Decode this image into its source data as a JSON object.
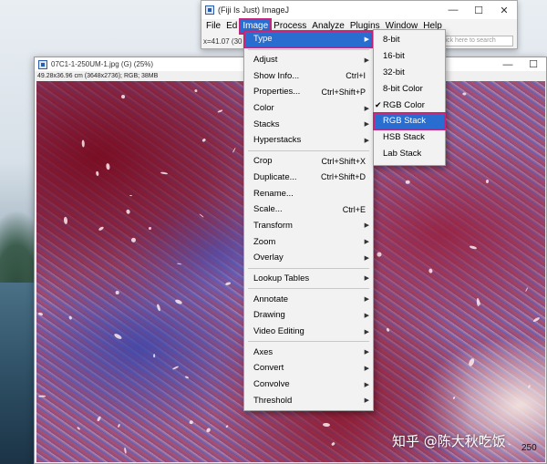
{
  "main_window": {
    "title": "(Fiji Is Just) ImageJ",
    "menus": [
      "File",
      "Ed",
      "Image",
      "Process",
      "Analyze",
      "Plugins",
      "Window",
      "Help"
    ],
    "active_menu": "Image",
    "status": "x=41.07 (30",
    "search_placeholder": "lick here to search",
    "controls": {
      "minimize": "—",
      "maximize": "☐",
      "close": "✕"
    }
  },
  "image_window": {
    "title": "07C1-1-250UM-1.jpg (G) (25%)",
    "subtitle": "49.28x36.96 cm (3648x2736); RGB; 38MB"
  },
  "image_menu": {
    "items": [
      {
        "label": "Type",
        "arrow": true,
        "selected": true
      },
      {
        "sep": true
      },
      {
        "label": "Adjust",
        "arrow": true
      },
      {
        "label": "Show Info...",
        "shortcut": "Ctrl+I"
      },
      {
        "label": "Properties...",
        "shortcut": "Ctrl+Shift+P"
      },
      {
        "label": "Color",
        "arrow": true
      },
      {
        "label": "Stacks",
        "arrow": true
      },
      {
        "label": "Hyperstacks",
        "arrow": true
      },
      {
        "sep": true
      },
      {
        "label": "Crop",
        "shortcut": "Ctrl+Shift+X"
      },
      {
        "label": "Duplicate...",
        "shortcut": "Ctrl+Shift+D"
      },
      {
        "label": "Rename..."
      },
      {
        "label": "Scale...",
        "shortcut": "Ctrl+E"
      },
      {
        "label": "Transform",
        "arrow": true
      },
      {
        "label": "Zoom",
        "arrow": true
      },
      {
        "label": "Overlay",
        "arrow": true
      },
      {
        "sep": true
      },
      {
        "label": "Lookup Tables",
        "arrow": true
      },
      {
        "sep": true
      },
      {
        "label": "Annotate",
        "arrow": true
      },
      {
        "label": "Drawing",
        "arrow": true
      },
      {
        "label": "Video Editing",
        "arrow": true
      },
      {
        "sep": true
      },
      {
        "label": "Axes",
        "arrow": true
      },
      {
        "label": "Convert",
        "arrow": true
      },
      {
        "label": "Convolve",
        "arrow": true
      },
      {
        "label": "Threshold",
        "arrow": true
      }
    ]
  },
  "type_submenu": {
    "items": [
      {
        "label": "8-bit"
      },
      {
        "label": "16-bit"
      },
      {
        "label": "32-bit"
      },
      {
        "label": "8-bit Color"
      },
      {
        "label": "RGB Color",
        "checked": true
      },
      {
        "label": "RGB Stack",
        "selected": true
      },
      {
        "label": "HSB Stack"
      },
      {
        "label": "Lab Stack"
      }
    ]
  },
  "watermark": "知乎 @陈大秋吃饭",
  "scale_label": "250",
  "colors": {
    "highlight": "#2a6dd0",
    "annotation": "#c7257a"
  }
}
